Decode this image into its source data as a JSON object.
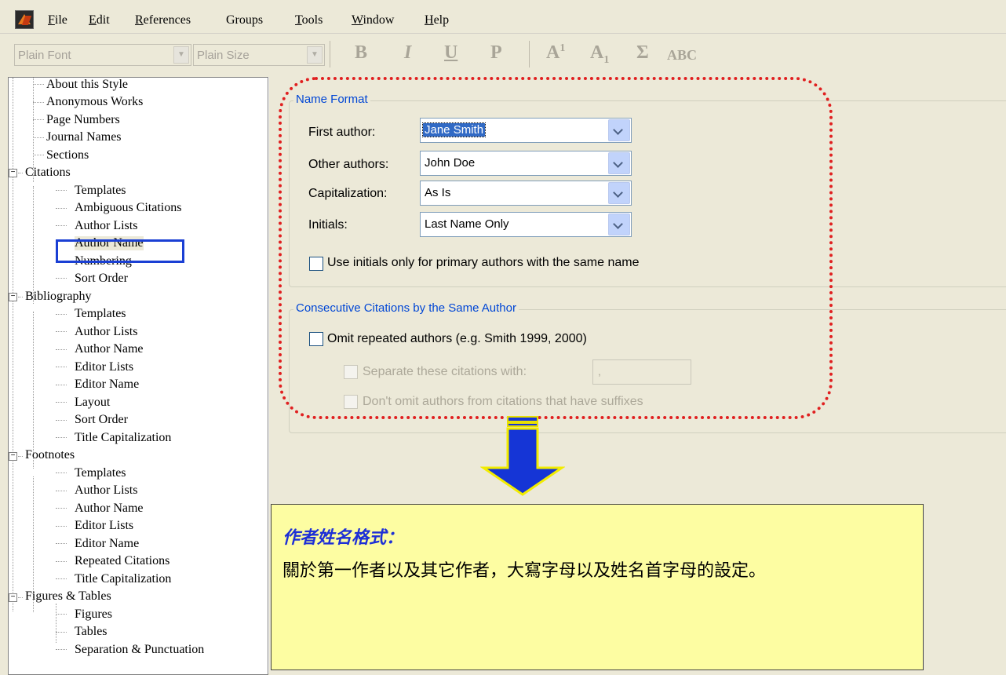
{
  "menu": {
    "file": "File",
    "edit": "Edit",
    "references": "References",
    "groups": "Groups",
    "tools": "Tools",
    "window": "Window",
    "help": "Help"
  },
  "toolbar": {
    "font": "Plain Font",
    "size": "Plain Size",
    "bold": "B",
    "italic": "I",
    "underline": "U",
    "plain": "P",
    "superscript_base": "A",
    "superscript_mark": "1",
    "subscript_base": "A",
    "subscript_mark": "1",
    "symbol": "Σ",
    "smallcaps": "ABC"
  },
  "tree": [
    "About this Style",
    "Anonymous Works",
    "Page Numbers",
    "Journal Names",
    "Sections",
    "Citations",
    "Templates",
    "Ambiguous Citations",
    "Author Lists",
    "Author Name",
    "Numbering",
    "Sort Order",
    "Bibliography",
    "Templates",
    "Author Lists",
    "Author Name",
    "Editor Lists",
    "Editor Name",
    "Layout",
    "Sort Order",
    "Title Capitalization",
    "Footnotes",
    "Templates",
    "Author Lists",
    "Author Name",
    "Editor Lists",
    "Editor Name",
    "Repeated Citations",
    "Title Capitalization",
    "Figures & Tables",
    "Figures",
    "Tables",
    "Separation & Punctuation"
  ],
  "name_format": {
    "title": "Name Format",
    "first_author_label": "First author:",
    "first_author_value": "Jane Smith",
    "other_authors_label": "Other authors:",
    "other_authors_value": "John Doe",
    "capitalization_label": "Capitalization:",
    "capitalization_value": "As Is",
    "initials_label": "Initials:",
    "initials_value": "Last Name Only",
    "use_initials_label": "Use initials only for primary authors with the same name"
  },
  "consecutive": {
    "title": "Consecutive Citations by the Same Author",
    "omit_label": "Omit repeated authors (e.g. Smith 1999, 2000)",
    "separate_label": "Separate these citations with:",
    "separator_value": ",",
    "dont_omit_label": "Don't omit authors from citations that have suffixes"
  },
  "note": {
    "title": "作者姓名格式：",
    "body": "關於第一作者以及其它作者，大寫字母以及姓名首字母的設定。"
  }
}
